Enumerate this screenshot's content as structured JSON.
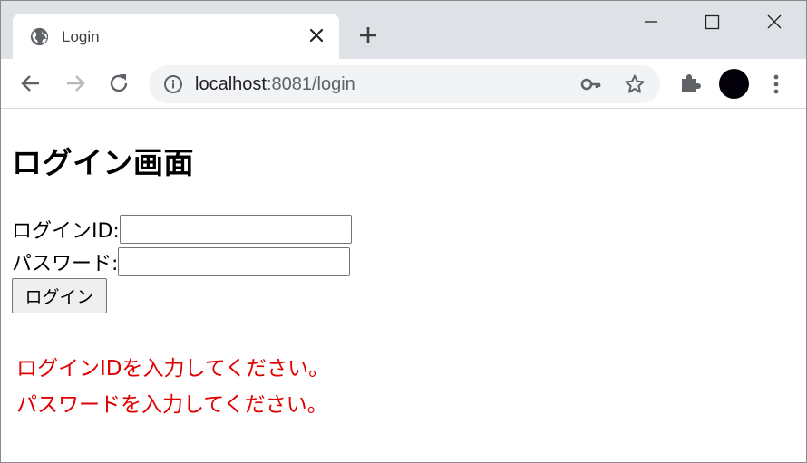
{
  "browser": {
    "tab": {
      "title": "Login",
      "favicon": "globe-icon",
      "close_icon": "close-icon"
    },
    "new_tab_icon": "plus-icon",
    "window_controls": [
      "minimize-icon",
      "maximize-icon",
      "close-icon"
    ],
    "toolbar": {
      "back_icon": "arrow-left-icon",
      "forward_icon": "arrow-right-icon",
      "reload_icon": "reload-icon",
      "site_info_icon": "info-icon",
      "url_host": "localhost",
      "url_rest": ":8081/login",
      "key_icon": "key-icon",
      "bookmark_icon": "star-icon",
      "extensions_icon": "puzzle-icon",
      "menu_icon": "kebab-menu-icon"
    }
  },
  "page": {
    "heading": "ログイン画面",
    "login_id_label": "ログインID:",
    "login_id_value": "",
    "password_label": "パスワード:",
    "password_value": "",
    "submit_label": "ログイン",
    "errors": [
      "ログインIDを入力してください。",
      "パスワードを入力してください。"
    ]
  },
  "colors": {
    "tabstrip_bg": "#dee1e6",
    "omnibox_bg": "#f1f3f4",
    "error_text": "#e00000",
    "avatar": "#05010a"
  }
}
